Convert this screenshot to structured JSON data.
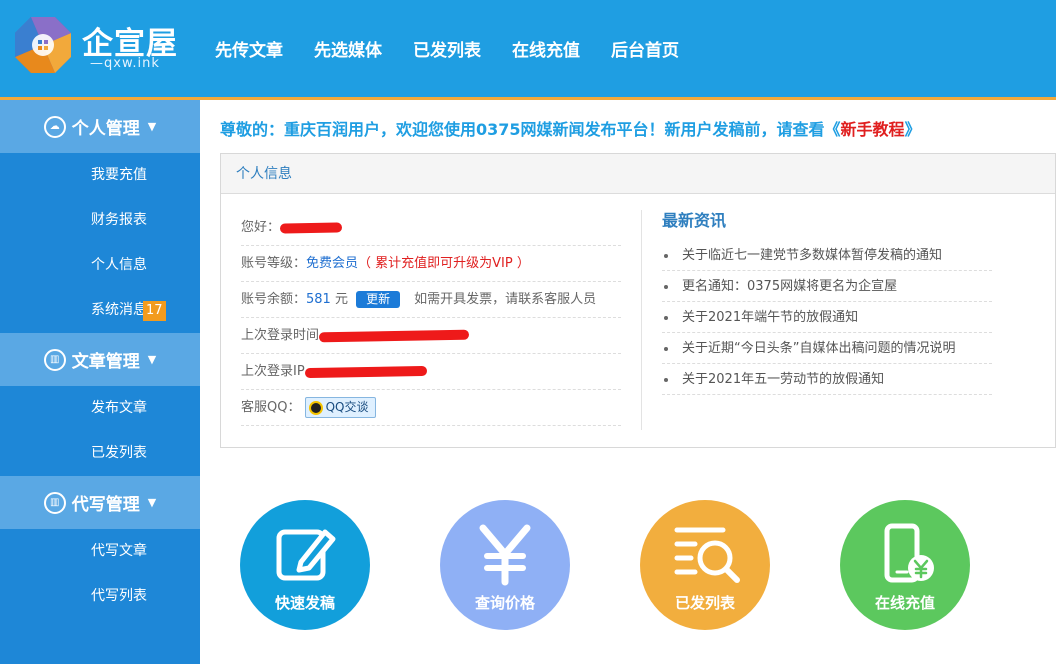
{
  "header": {
    "logo_title": "企宣屋",
    "logo_sub": "—qxw.ink",
    "nav": [
      "先传文章",
      "先选媒体",
      "已发列表",
      "在线充值",
      "后台首页"
    ]
  },
  "sidebar": {
    "sections": [
      {
        "title": "个人管理",
        "items": [
          "我要充值",
          "财务报表",
          "个人信息",
          "系统消息"
        ]
      },
      {
        "title": "文章管理",
        "items": [
          "发布文章",
          "已发列表"
        ]
      },
      {
        "title": "代写管理",
        "items": [
          "代写文章",
          "代写列表"
        ]
      }
    ],
    "message_badge": "17"
  },
  "notice": {
    "prefix": "尊敬的：重庆百润用户，欢迎您使用0375网媒新闻发布平台！新用户发稿前，请查看《",
    "link": "新手教程",
    "suffix": "》"
  },
  "panel": {
    "title": "个人信息",
    "greeting_label": "您好：",
    "level_label": "账号等级：",
    "level_value": "免费会员",
    "level_hint": "（ 累计充值即可升级为VIP ）",
    "balance_label": "账号余额：",
    "balance_value": "581",
    "balance_unit": "元",
    "update_button": "更新",
    "invoice_hint": "如需开具发票，请联系客服人员",
    "last_login_time_label": "上次登录时间",
    "last_login_ip_label": "上次登录IP",
    "service_qq_label": "客服QQ：",
    "qq_button": "QQ交谈"
  },
  "news": {
    "title": "最新资讯",
    "items": [
      "关于临近七一建党节多数媒体暂停发稿的通知",
      "更名通知：0375网媒将更名为企宣屋",
      "关于2021年端午节的放假通知",
      "关于近期“今日头条”自媒体出稿问题的情况说明",
      "关于2021年五一劳动节的放假通知"
    ]
  },
  "shortcuts": [
    {
      "label": "快速发稿",
      "color": "#129fdb",
      "icon": "edit-icon"
    },
    {
      "label": "查询价格",
      "color": "#8fb0f5",
      "icon": "yen-icon"
    },
    {
      "label": "已发列表",
      "color": "#f2ae3e",
      "icon": "list-search-icon"
    },
    {
      "label": "在线充值",
      "color": "#5cc85e",
      "icon": "phone-yen-icon"
    }
  ]
}
